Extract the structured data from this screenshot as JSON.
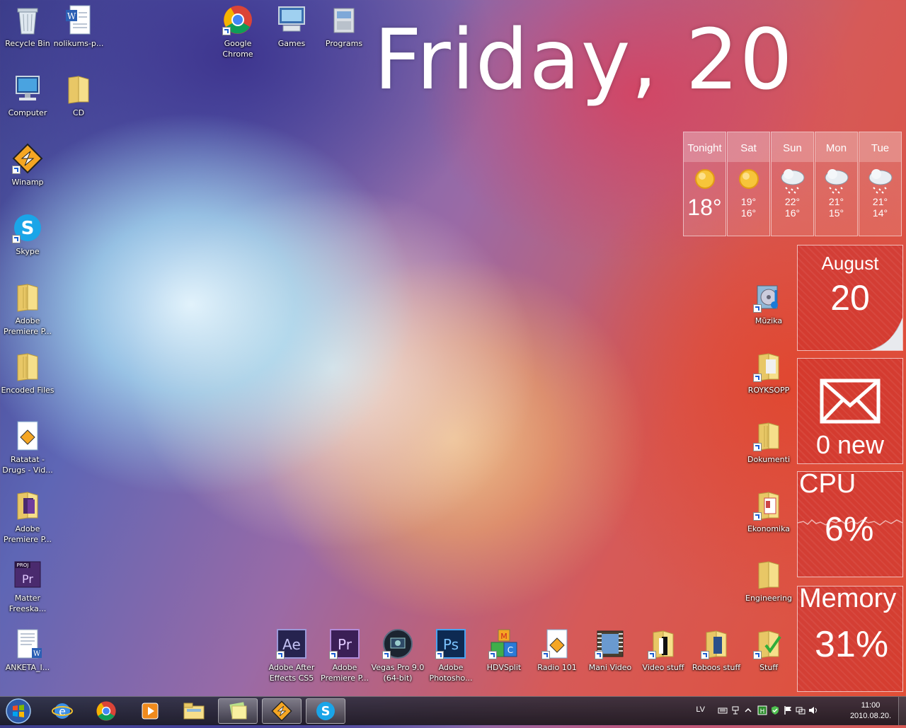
{
  "desktop": {
    "big_date": "Friday, 20",
    "icons_left": [
      {
        "label": "Recycle Bin",
        "icon": "recycle-bin-icon"
      },
      {
        "label": "nolikums-p...",
        "icon": "word-document-icon"
      },
      {
        "label": "Computer",
        "icon": "computer-icon"
      },
      {
        "label": "CD",
        "icon": "folder-icon"
      },
      {
        "label": "Winamp",
        "icon": "winamp-icon"
      },
      {
        "label": "Skype",
        "icon": "skype-icon"
      },
      {
        "label": "Adobe Premiere P...",
        "icon": "folder-icon"
      },
      {
        "label": "Encoded Files",
        "icon": "folder-icon"
      },
      {
        "label": "Ratatat - Drugs - Vid...",
        "icon": "media-file-icon"
      },
      {
        "label": "Adobe Premiere P...",
        "icon": "premiere-folder-icon"
      },
      {
        "label": "Matter Freeska...",
        "icon": "premiere-project-icon"
      },
      {
        "label": "ANKETA_I...",
        "icon": "word-document-icon"
      }
    ],
    "icons_top": [
      {
        "label": "Google Chrome",
        "icon": "chrome-icon"
      },
      {
        "label": "Games",
        "icon": "games-icon"
      },
      {
        "label": "Programs",
        "icon": "programs-icon"
      }
    ],
    "icons_right": [
      {
        "label": "Mūzika",
        "icon": "music-folder-icon"
      },
      {
        "label": "ROYKSOPP",
        "icon": "folder-icon"
      },
      {
        "label": "Dokumenti",
        "icon": "folder-icon"
      },
      {
        "label": "Ekonomika",
        "icon": "folder-icon"
      },
      {
        "label": "Engineering",
        "icon": "folder-icon"
      }
    ],
    "icons_bottom": [
      {
        "label": "Adobe After Effects CS5",
        "icon": "after-effects-icon"
      },
      {
        "label": "Adobe Premiere P...",
        "icon": "premiere-icon"
      },
      {
        "label": "Vegas Pro 9.0 (64-bit)",
        "icon": "vegas-icon"
      },
      {
        "label": "Adobe Photosho...",
        "icon": "photoshop-icon"
      },
      {
        "label": "HDVSplit",
        "icon": "hdvsplit-icon"
      },
      {
        "label": "Radio 101",
        "icon": "media-file-icon"
      },
      {
        "label": "Mani Video",
        "icon": "video-folder-icon"
      },
      {
        "label": "Video stuff",
        "icon": "folder-icon"
      },
      {
        "label": "Roboos stuff",
        "icon": "folder-icon"
      },
      {
        "label": "Stuff",
        "icon": "folder-check-icon"
      }
    ]
  },
  "weather": {
    "days": [
      {
        "name": "Tonight",
        "icon": "sun-icon",
        "now": "18°"
      },
      {
        "name": "Sat",
        "icon": "sun-icon",
        "hi": "19°",
        "lo": "16°"
      },
      {
        "name": "Sun",
        "icon": "snow-cloud-icon",
        "hi": "22°",
        "lo": "16°"
      },
      {
        "name": "Mon",
        "icon": "snow-cloud-icon",
        "hi": "21°",
        "lo": "15°"
      },
      {
        "name": "Tue",
        "icon": "snow-cloud-icon",
        "hi": "21°",
        "lo": "14°"
      }
    ]
  },
  "calendar": {
    "month": "August",
    "day": "20"
  },
  "mail": {
    "count": "0 new"
  },
  "cpu": {
    "title": "CPU",
    "value": "6%"
  },
  "memory": {
    "title": "Memory",
    "value": "31%"
  },
  "taskbar": {
    "pinned": [
      "internet-explorer-icon",
      "chrome-icon",
      "media-player-icon",
      "explorer-icon",
      "sticky-notes-icon",
      "winamp-icon",
      "skype-icon"
    ],
    "language": "LV",
    "time": "11:00",
    "date": "2010.08.20."
  },
  "colors": {
    "tile_bg": "#c82828",
    "accent": "#ffffff"
  }
}
